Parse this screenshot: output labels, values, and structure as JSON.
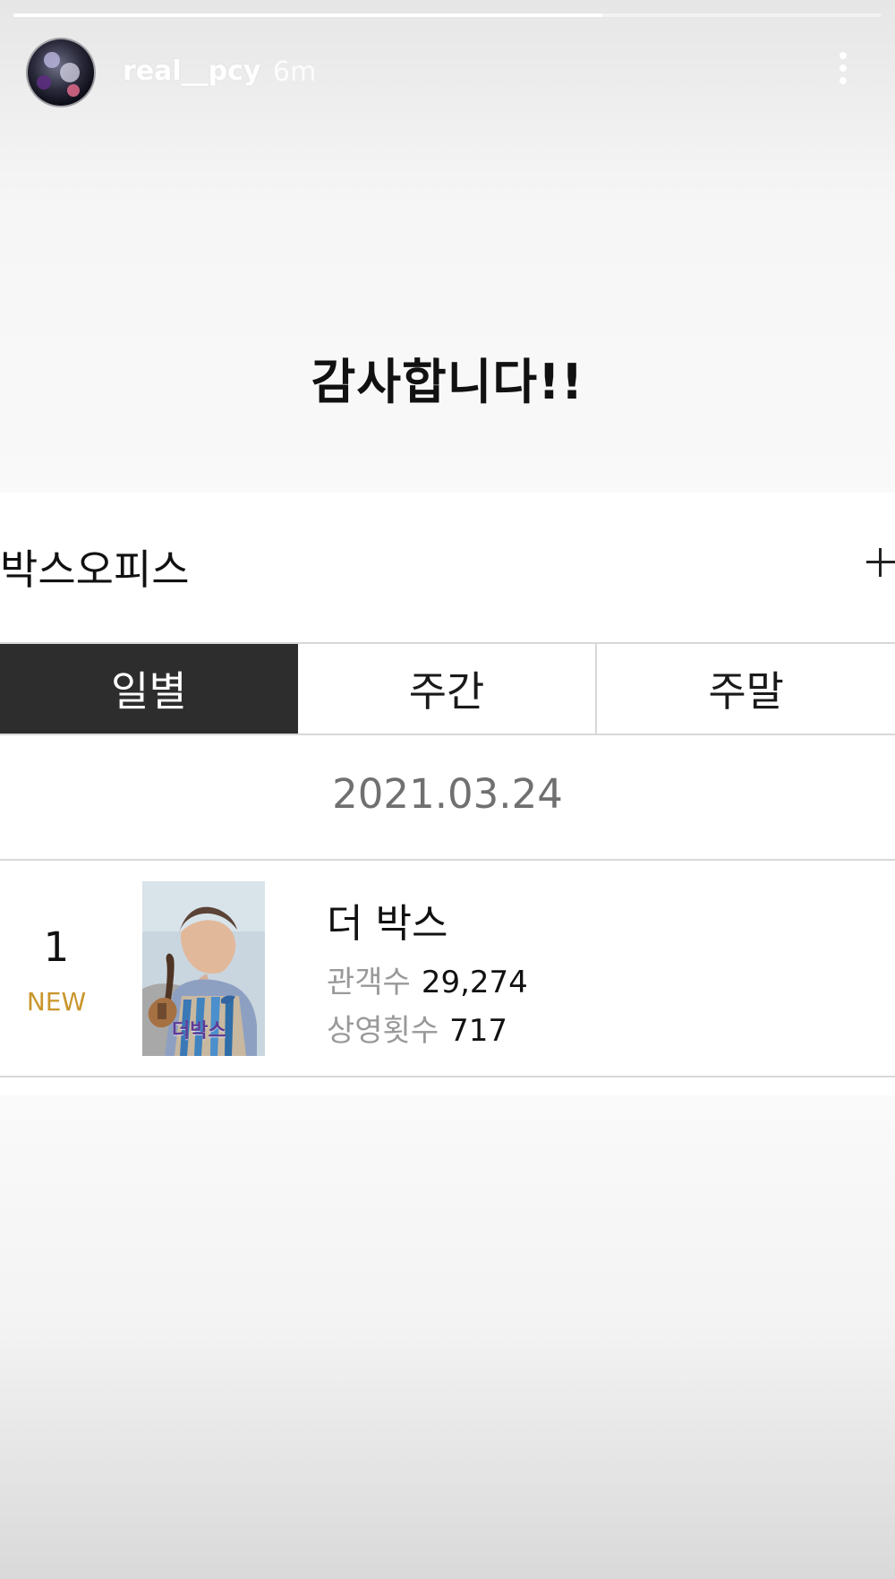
{
  "story": {
    "progress": 0.678,
    "username": "real__pcy",
    "time": "6m"
  },
  "caption": "감사합니다!!",
  "boxoffice": {
    "title": "박스오피스",
    "tabs": [
      {
        "label": "일별",
        "active": true
      },
      {
        "label": "주간",
        "active": false
      },
      {
        "label": "주말",
        "active": false
      }
    ],
    "date": "2021.03.24",
    "entries": [
      {
        "rank": "1",
        "badge": "NEW",
        "poster_title": "더박스",
        "title": "더 박스",
        "audience_label": "관객수",
        "audience_value": "29,274",
        "screenings_label": "상영횟수",
        "screenings_value": "717"
      }
    ]
  }
}
